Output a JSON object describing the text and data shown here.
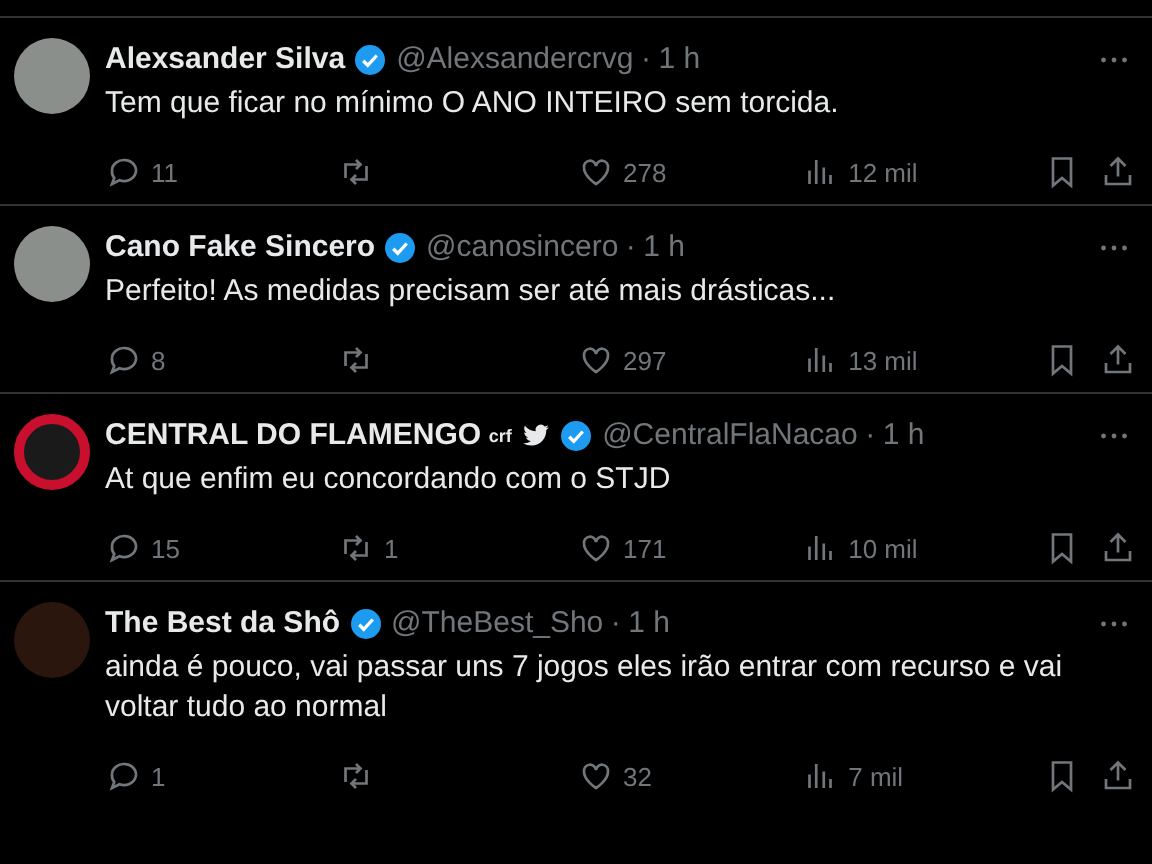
{
  "tweets": [
    {
      "kind": "photo",
      "name": "Alexsander Silva",
      "verified": true,
      "handle": "@Alexsandercrvg",
      "separator": "·",
      "time": "1 h",
      "text": "Tem que ficar no mínimo O ANO INTEIRO sem torcida.",
      "replies": "11",
      "likes": "278",
      "views": "12 mil"
    },
    {
      "kind": "photo",
      "name": "Cano Fake Sincero",
      "verified": true,
      "handle": "@canosincero",
      "separator": "·",
      "time": "1 h",
      "text": "Perfeito! As medidas precisam ser até mais drásticas...",
      "replies": "8",
      "likes": "297",
      "views": "13 mil"
    },
    {
      "kind": "badge",
      "name": "CENTRAL DO FLAMENGO",
      "name_tag": "crf",
      "bird": true,
      "verified": true,
      "handle": "@CentralFlaNacao",
      "separator": "·",
      "time": "1 h",
      "text": "At que enfim eu concordando com o STJD",
      "replies": "15",
      "reposts": "1",
      "likes": "171",
      "views": "10 mil"
    },
    {
      "kind": "logo",
      "name": "The Best da Shô",
      "verified": true,
      "handle": "@TheBest_Sho",
      "separator": "·",
      "time": "1 h",
      "text": "ainda é pouco, vai passar uns 7 jogos eles irão entrar com recurso e vai voltar tudo ao normal",
      "replies": "1",
      "likes": "32",
      "views": "7 mil"
    }
  ]
}
